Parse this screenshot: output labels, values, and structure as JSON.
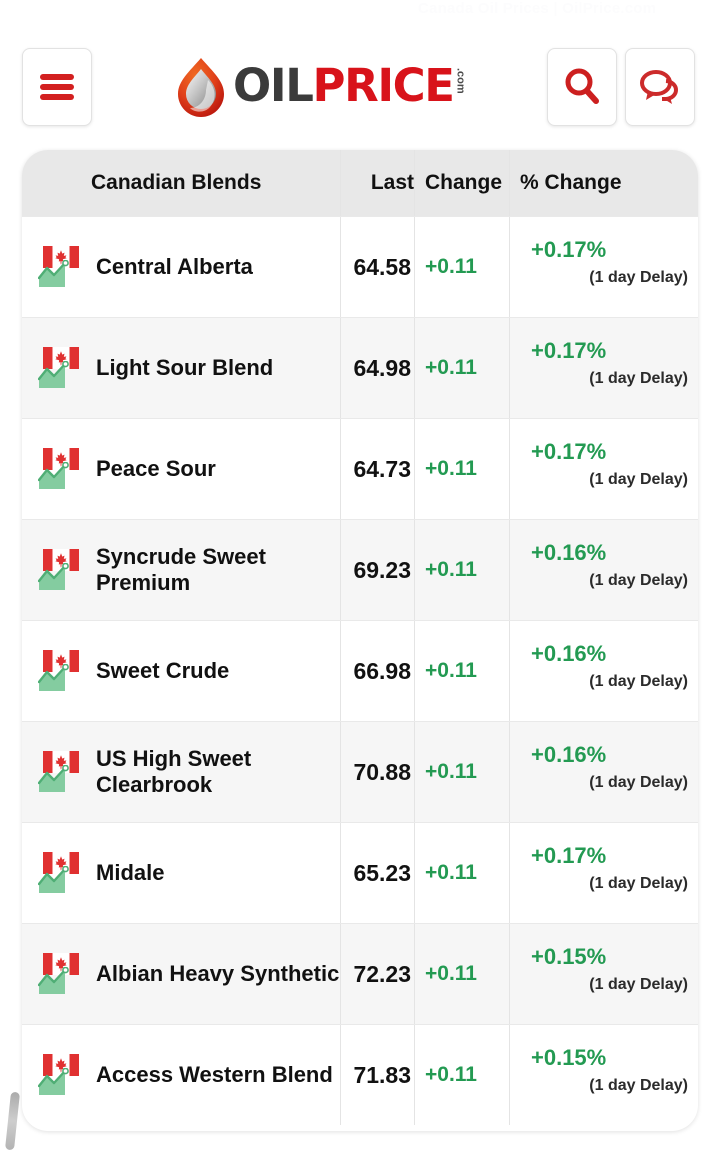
{
  "top_ghost_text": "Canada Oil Prices | OilPrice.com",
  "header": {
    "menu_label": "Menu",
    "logo": {
      "part1": "OIL",
      "part2": "PRICE",
      "suffix": ".com"
    },
    "search_label": "Search",
    "chat_label": "Chat"
  },
  "table": {
    "columns": [
      "Canadian Blends",
      "Last",
      "Change",
      "% Change"
    ],
    "rows": [
      {
        "flag": "canada-flag-icon",
        "chart": "trend-up-icon",
        "name": "Central Alberta",
        "last": "64.58",
        "change": "+0.11",
        "pct": "+0.17%",
        "delay": "(1 day Delay)"
      },
      {
        "flag": "canada-flag-icon",
        "chart": "trend-up-icon",
        "name": "Light Sour Blend",
        "last": "64.98",
        "change": "+0.11",
        "pct": "+0.17%",
        "delay": "(1 day Delay)"
      },
      {
        "flag": "canada-flag-icon",
        "chart": "trend-up-icon",
        "name": "Peace Sour",
        "last": "64.73",
        "change": "+0.11",
        "pct": "+0.17%",
        "delay": "(1 day Delay)"
      },
      {
        "flag": "canada-flag-icon",
        "chart": "trend-up-icon",
        "name": "Syncrude Sweet Premium",
        "last": "69.23",
        "change": "+0.11",
        "pct": "+0.16%",
        "delay": "(1 day Delay)"
      },
      {
        "flag": "canada-flag-icon",
        "chart": "trend-up-icon",
        "name": "Sweet Crude",
        "last": "66.98",
        "change": "+0.11",
        "pct": "+0.16%",
        "delay": "(1 day Delay)"
      },
      {
        "flag": "canada-flag-icon",
        "chart": "trend-up-icon",
        "name": "US High Sweet Clearbrook",
        "last": "70.88",
        "change": "+0.11",
        "pct": "+0.16%",
        "delay": "(1 day Delay)"
      },
      {
        "flag": "canada-flag-icon",
        "chart": "trend-up-icon",
        "name": "Midale",
        "last": "65.23",
        "change": "+0.11",
        "pct": "+0.17%",
        "delay": "(1 day Delay)"
      },
      {
        "flag": "canada-flag-icon",
        "chart": "trend-up-icon",
        "name": "Albian Heavy Synthetic",
        "last": "72.23",
        "change": "+0.11",
        "pct": "+0.15%",
        "delay": "(1 day Delay)"
      },
      {
        "flag": "canada-flag-icon",
        "chart": "trend-up-icon",
        "name": "Access Western Blend",
        "last": "71.83",
        "change": "+0.11",
        "pct": "+0.15%",
        "delay": "(1 day Delay)"
      }
    ]
  },
  "colors": {
    "brand_red": "#d8131a",
    "positive_green": "#239a52",
    "header_gray": "#e8e8e8",
    "row_alt": "#f6f6f6",
    "text_dark": "#111111"
  }
}
